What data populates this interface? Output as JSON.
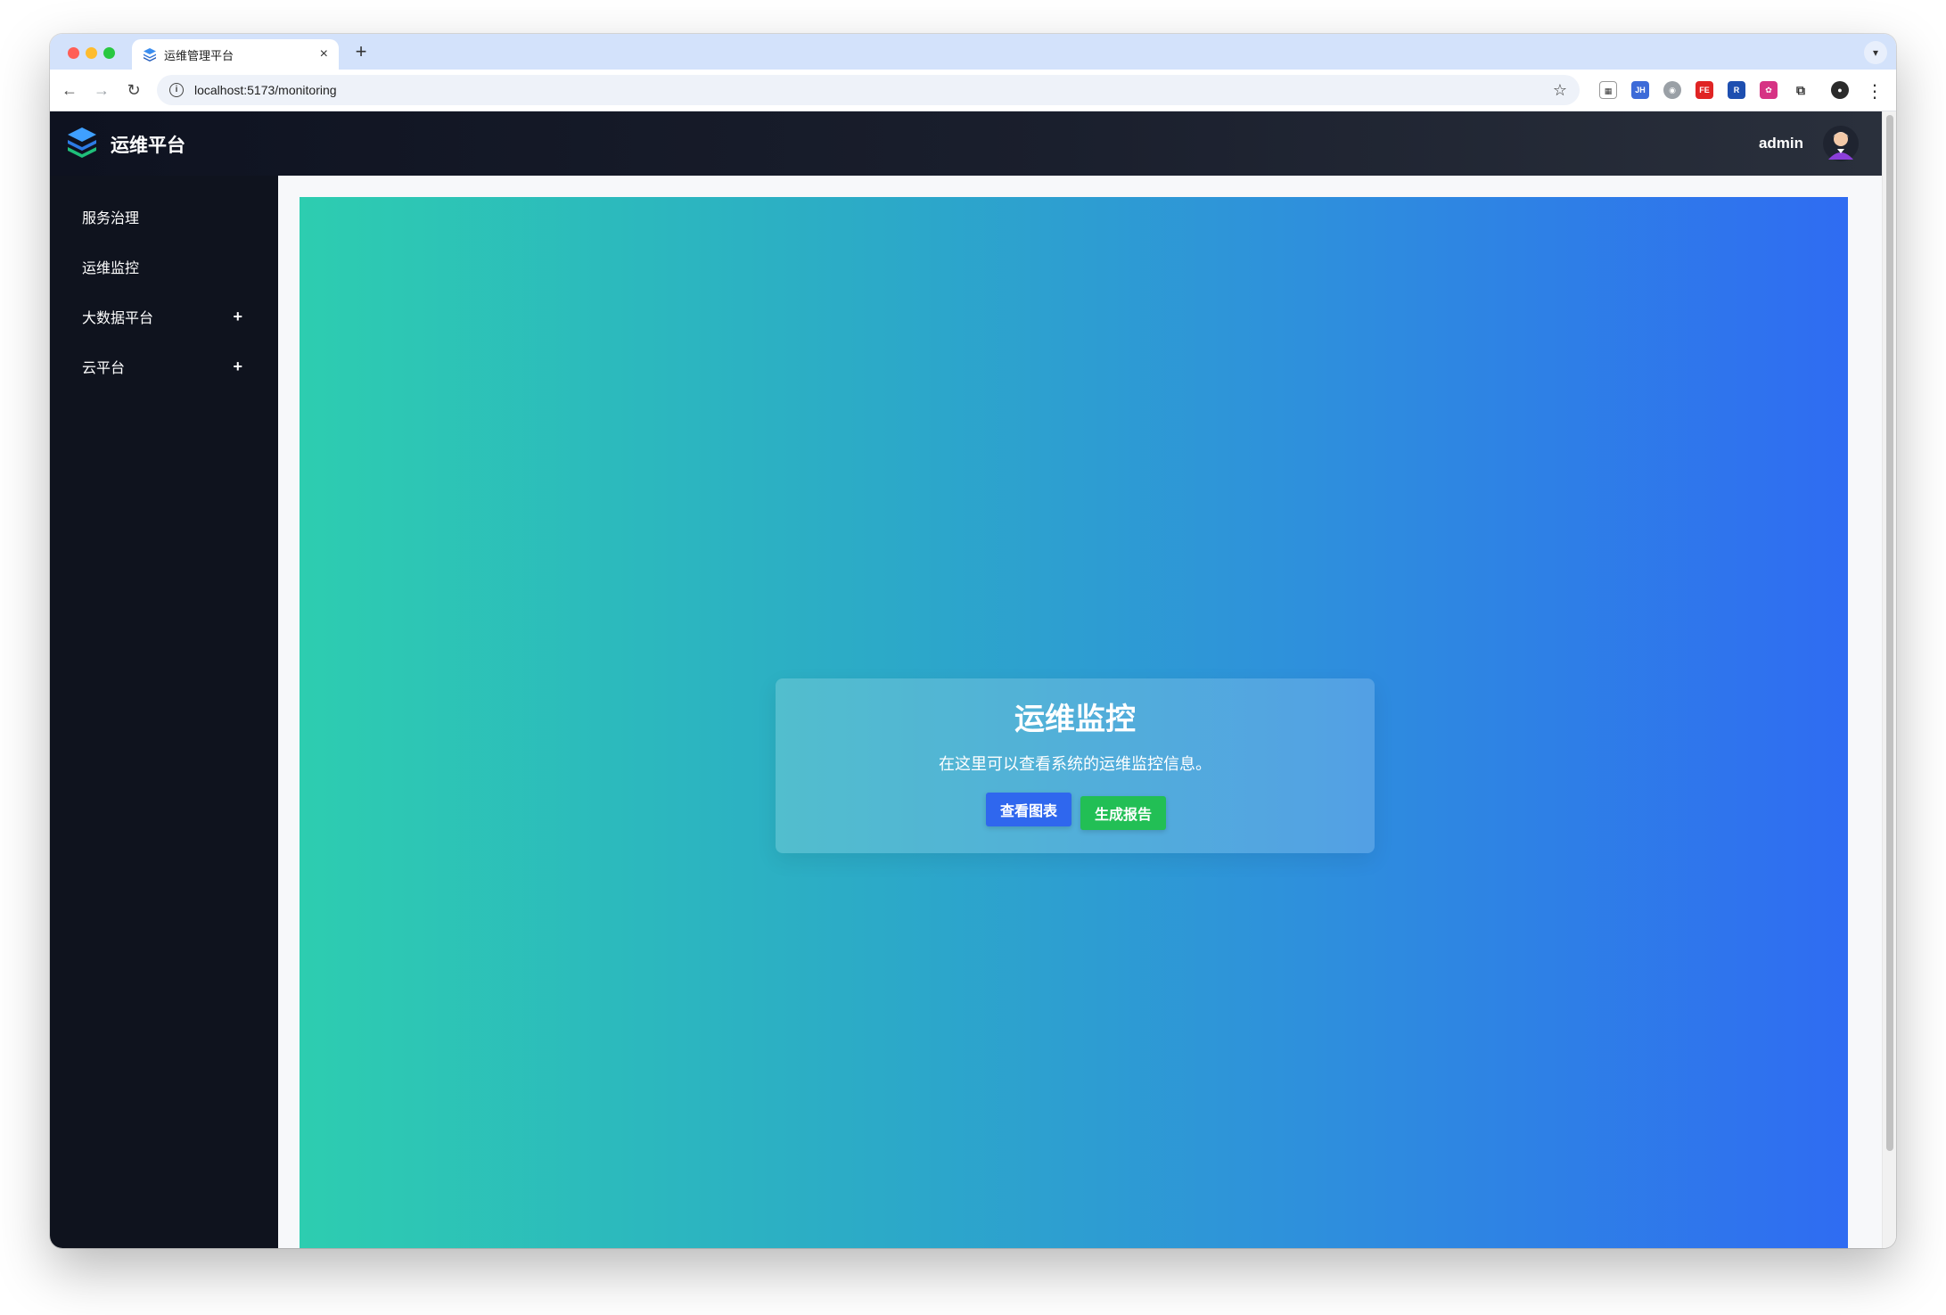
{
  "browser": {
    "tab_title": "运维管理平台",
    "new_tab": "+",
    "tab_close": "×",
    "url": "localhost:5173/monitoring",
    "extensions": [
      "qr-code-icon",
      "jh-extension-icon",
      "shield-extension-icon",
      "fe-extension-icon",
      "bookmark-extension-icon",
      "color-extension-icon",
      "puzzle-icon",
      "profile-icon"
    ]
  },
  "app": {
    "title": "运维平台",
    "username": "admin"
  },
  "sidebar": {
    "items": [
      {
        "label": "服务治理",
        "expandable": false
      },
      {
        "label": "运维监控",
        "expandable": false
      },
      {
        "label": "大数据平台",
        "expandable": true,
        "toggle": "+"
      },
      {
        "label": "云平台",
        "expandable": true,
        "toggle": "+"
      }
    ]
  },
  "main": {
    "title": "运维监控",
    "description": "在这里可以查看系统的运维监控信息。",
    "view_chart_button": "查看图表",
    "generate_report_button": "生成报告"
  },
  "colors": {
    "gradient_start": "#2dcdb0",
    "gradient_end": "#2f6cf2",
    "chart_button": "#2f67ee",
    "report_button": "#22bf55",
    "sidebar_bg": "#0f131e"
  }
}
